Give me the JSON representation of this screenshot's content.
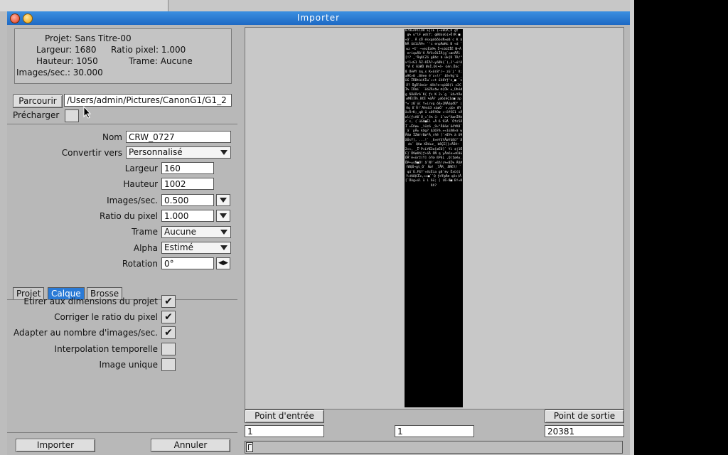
{
  "window": {
    "title": "Importer"
  },
  "info": {
    "project": "Projet: Sans Titre-00",
    "width": "Largeur: 1680",
    "pixel_ratio": "Ratio pixel: 1.000",
    "height": "Hauteur: 1050",
    "frame": "Trame: Aucune",
    "fps": "Images/sec.: 30.000"
  },
  "browse": {
    "label": "Parcourir",
    "path": "/Users/admin/Pictures/CanonG1/G1_2"
  },
  "preload": {
    "label": "Précharger"
  },
  "form": {
    "name_label": "Nom",
    "name_value": "CRW_0727",
    "convert_label": "Convertir vers",
    "convert_value": "Personnalisé",
    "width_label": "Largeur",
    "width_value": "160",
    "height_label": "Hauteur",
    "height_value": "1002",
    "fps_label": "Images/sec.",
    "fps_value": "0.500",
    "ratio_label": "Ratio du pixel",
    "ratio_value": "1.000",
    "frame_label": "Trame",
    "frame_value": "Aucune",
    "alpha_label": "Alpha",
    "alpha_value": "Estimé",
    "rotation_label": "Rotation",
    "rotation_value": "0°"
  },
  "tabs": [
    {
      "label": "Projet"
    },
    {
      "label": "Calque"
    },
    {
      "label": "Brosse"
    }
  ],
  "options": [
    {
      "label": "Etirer aux dimensions du projet",
      "checked": true
    },
    {
      "label": "Corriger le ratio du pixel",
      "checked": true
    },
    {
      "label": "Adapter au nombre d'images/sec.",
      "checked": true
    },
    {
      "label": "Interpolation temporelle",
      "checked": false
    },
    {
      "label": "Image unique",
      "checked": false
    }
  ],
  "bottom": {
    "import_label": "Importer",
    "cancel_label": "Annuler"
  },
  "points": {
    "in_label": "Point d'entrée",
    "out_label": "Point de sortie",
    "in_value": "1",
    "current_value": "1",
    "out_value": "20381"
  },
  "preview": {
    "garbage_text": "8?HEAPCCOR Ê|IE {~ü0ÕA,Õ gt `g% u\"lF ød(f; gØdúúG|>ÕrR ■ «ä', Â ¢Õ ésxgdõôõsÑ»øã`c K $ NÅ üõ1iÂ9« `'c enpÄœNc Ð «d `wz •š' ~¤ezÈa9% Î~sú©ZÎÈ N~À eriquÂô'À ÂYë«ÔiÎÂ|g`«ønÄÂl [!? _'ÅqßCZö gBãc b ük{Ú TR/\" v!1<G1 ÅZ-ßÌÀ?~yäØk{`),J'~ú!ô*À € Á3ØÔ ØnÌ.Ð{•ë- Łén_Õác` Œ Üë#Y $q_s K«ö(8\"/— zü`j' ñ; ±9€»0 .8ëee é`c«!/` £è»Vg`ü _üG ÎÜBtùi€Ìw`»»t £éßYƒ'ε_■ `vÂ? ÖgÖlèeúr 4ëk?e~qúGÐ(l c2CÏ% ÏÕmi` ´ëóZÄcðw ®[Õk ±_Ûhédg åÂóÄrè`K{ ƒs K 2»`g `üã»YÄeøMÊ[Õh_ß€Ë %õÂ? ¿ø6¢ëÇ1ε■`àp*«`zŒ`ü{ Y¤irvg óß»2ÑÂópðÜ\" |ñq ß`Å!`Ãénü3 xùøÔ` »,qü« ØYä«ÄrK;_q0 ü ±0Fñ9ø «~öf€Ε1 vÂ ol(ƒ«Aß`Ù_«`ë% ü- ü`wv\"XønÌRhc`s, (`üGñ■Èl «Â 6 93Â `Öfs5ÂÌ`»Êñø± _ìüzä _9«\"Å8ëø`äèYK8``ä``pÅ± kãg? Δ1Œ?ê_««1üXØ»à`wÅñø ÎZWrrBø*À_rñé ]`×ŒΥ% à ö9äÛsY], ...!` _ß¤eYüYÅøYüßü\"`ådv` Qñø XÕé±z_ bßÇE[}»ÂÕè~2»«, _Ï'P«LYŒ3a[øEÙ]` Yi ¢|1ÖF]`Ü9øßñ]ƒ•öÅ ÔÑ q yÅa€e»e€0üÓÂ'è«ürž(Y] õfœ ßP§L ,Q[ƒøéy_ ÕP•±sÑ■Ö! ã`Ñ?`»ßñ!c%«ŒÎ% Âß#fØQÔ¬gt_Ó` Âœ! _7ÅR_ åÑ€Y/ ` qü`Ù.Fß?`«ëzÈia g8`®v Êxü(üY»ñUQCÊc,««■``Q ƒeŸ@Â® qës(Â[`Üòg«úl ü i ôü; [ LŒ-Œ■ B!»0 ßñ?"
  }
}
